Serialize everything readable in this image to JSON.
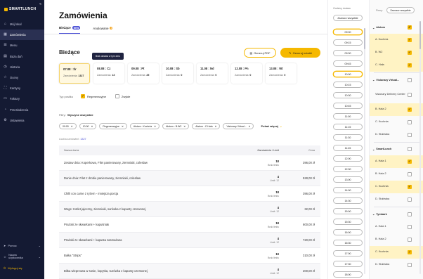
{
  "app": {
    "brand": "SMARTLUNCH"
  },
  "sidebar": {
    "items": [
      {
        "label": "Mój lokal",
        "icon": "home-icon"
      },
      {
        "label": "Zamówienia",
        "icon": "orders-icon",
        "active": true
      },
      {
        "label": "Menu",
        "icon": "menu-icon"
      },
      {
        "label": "Baza dań",
        "icon": "dishes-icon"
      },
      {
        "label": "Historia",
        "icon": "history-icon"
      },
      {
        "label": "Oceny",
        "icon": "star-icon"
      },
      {
        "label": "Kantyny",
        "icon": "canteen-icon"
      },
      {
        "label": "Faktury",
        "icon": "invoice-icon"
      },
      {
        "label": "Przesłodzenia",
        "icon": "stats-icon"
      },
      {
        "label": "Ustawienia",
        "icon": "gear-icon"
      }
    ],
    "help": "Pomoc",
    "user_line1": "Nazwa",
    "user_line2": "użytkownika",
    "logout": "Wyloguj się"
  },
  "main": {
    "title": "Zamówienia",
    "tabs": [
      {
        "label": "Bieżące",
        "badge": "NEW"
      },
      {
        "label": "Anulowane",
        "badge": "2"
      }
    ],
    "section_title": "Bieżące",
    "pdf_button": "Generuj PDF",
    "notes_button": "Generuj notatki",
    "tooltip": "Brak dostaw w tym dniu",
    "days": [
      {
        "date": "07.08 : Śr",
        "label": "Zamówienia:",
        "count": "1327",
        "active": true
      },
      {
        "date": "08.08 : Cz",
        "label": "Zamówienia:",
        "count": "13"
      },
      {
        "date": "09.08 : Pt",
        "label": "Zamówienia:",
        "count": "25"
      },
      {
        "date": "10.08 : Sb",
        "label": "Zamówienia:",
        "count": "0"
      },
      {
        "date": "11.08 : Nd",
        "label": "Zamówienia:",
        "count": "0"
      },
      {
        "date": "12.08 : Pn",
        "label": "Zamówienia:",
        "count": "0"
      },
      {
        "date": "13.08 : Wt",
        "label": "Zamówienia:",
        "count": "0"
      }
    ],
    "type_label": "Typ posiłku",
    "type_options": [
      {
        "label": "Regeneracyjne",
        "checked": true
      },
      {
        "label": "Zwykłe",
        "checked": false
      }
    ],
    "filters_label": "Filtry:",
    "filters_clear": "Wyczyść wszystkie",
    "chips": [
      "09:00",
      "10:00",
      "Regeneracyjne",
      "Alstom : Kuchnia",
      "Alstom : B.W2",
      "Alstom : C.Hala",
      "Visionary Virtual..."
    ],
    "more_label": "Pokaż więcej",
    "orders_count_label": "Liczba zamówień:",
    "orders_count": "1327",
    "columns": {
      "name": "Nazwa dania",
      "qty": "Zamówienia / Limit",
      "price": "Cena"
    },
    "rows": [
      {
        "name": "Zestaw dnia: Koperkowa, Filet panierowany, ziemniaki, coleslaw",
        "qty": "18",
        "limit": "Brak limitu",
        "price": "396,00 zł"
      },
      {
        "name": "Danie dnia: Filet z drobiu panierowany, ziemniaki, coleslaw",
        "qty": "4",
        "limit": "Limit: 12",
        "price": "528,00 zł"
      },
      {
        "name": "Chilli con carne z ryżem - mniejsza porcja",
        "qty": "18",
        "limit": "Brak limitu",
        "price": "396,00 zł"
      },
      {
        "name": "Wege: Kotlet jajeczny, ziemniaki, surówka z kapusty czerwonej",
        "qty": "4",
        "limit": "Limit: 12",
        "price": "32,00 zł"
      },
      {
        "name": "Prażoki ze skwarkami + kapuśniak",
        "qty": "18",
        "limit": "Brak limitu",
        "price": "600,00 zł"
      },
      {
        "name": "Prażoki ze skwarkami + kapusta zasmażana",
        "qty": "4",
        "limit": "Limit: 12",
        "price": "720,00 zł"
      },
      {
        "name": "Bułka \"Strips\"",
        "qty": "19",
        "limit": "Brak limitu",
        "price": "310,00 zł"
      },
      {
        "name": "Bitka wieprzowa w sosie, kopytka, surówka z kapusty czerwonej",
        "qty": "4",
        "limit": "Limit: 12",
        "price": "200,00 zł"
      }
    ]
  },
  "delivery": {
    "label": "Godziny dostaw",
    "select_all": "Zaznacz wszystkie",
    "times": [
      {
        "t": "09:00",
        "sel": true
      },
      {
        "t": "09:15"
      },
      {
        "t": "09:30"
      },
      {
        "t": "09:45"
      },
      {
        "t": "10:00",
        "sel": true
      },
      {
        "t": "10:15"
      },
      {
        "t": "10:30"
      },
      {
        "t": "10:45"
      },
      {
        "t": "11:00"
      },
      {
        "t": "11:15"
      },
      {
        "t": "11:30"
      },
      {
        "t": "11:45"
      },
      {
        "t": "12:00"
      },
      {
        "t": "12:30"
      },
      {
        "t": "13:00"
      },
      {
        "t": "14:00"
      },
      {
        "t": "14:30"
      },
      {
        "t": "15:00"
      },
      {
        "t": "15:30"
      },
      {
        "t": "16:00"
      },
      {
        "t": "16:30"
      },
      {
        "t": "17:00"
      },
      {
        "t": "17:30"
      },
      {
        "t": "18:00"
      }
    ]
  },
  "companies": {
    "label": "Firmy:",
    "select_all": "Zaznacz wszystkie",
    "groups": [
      {
        "name": "Alstom",
        "checked": true,
        "items": [
          {
            "label": "A. Kuchnia",
            "checked": true
          },
          {
            "label": "B. W2",
            "checked": true
          },
          {
            "label": "C. Hala",
            "checked": true
          }
        ]
      },
      {
        "name": "Visionary Virtual...",
        "checked": false,
        "items": [
          {
            "label": "Visionary Delivery Center",
            "checked": false
          },
          {
            "label": "B. Hala 2",
            "checked": true
          },
          {
            "label": "C. Kuchnia",
            "checked": false
          },
          {
            "label": "D. Stołówka",
            "checked": false
          }
        ]
      },
      {
        "name": "SmartLunch",
        "checked": false,
        "items": [
          {
            "label": "A. Hala 1",
            "checked": true
          },
          {
            "label": "B. Hala 2",
            "checked": false
          },
          {
            "label": "C. Kuchnia",
            "checked": true
          },
          {
            "label": "D. Stołówka",
            "checked": false
          }
        ]
      },
      {
        "name": "Tymbark",
        "checked": false,
        "items": [
          {
            "label": "A. Hala 1",
            "checked": false
          },
          {
            "label": "B. Hala 2",
            "checked": false
          },
          {
            "label": "C. Kuchnia",
            "checked": true
          },
          {
            "label": "D. Stołówka",
            "checked": false
          }
        ]
      }
    ]
  },
  "colors": {
    "accent": "#f5b800",
    "sidebar": "#141a33",
    "primary": "#4a4fd6"
  }
}
